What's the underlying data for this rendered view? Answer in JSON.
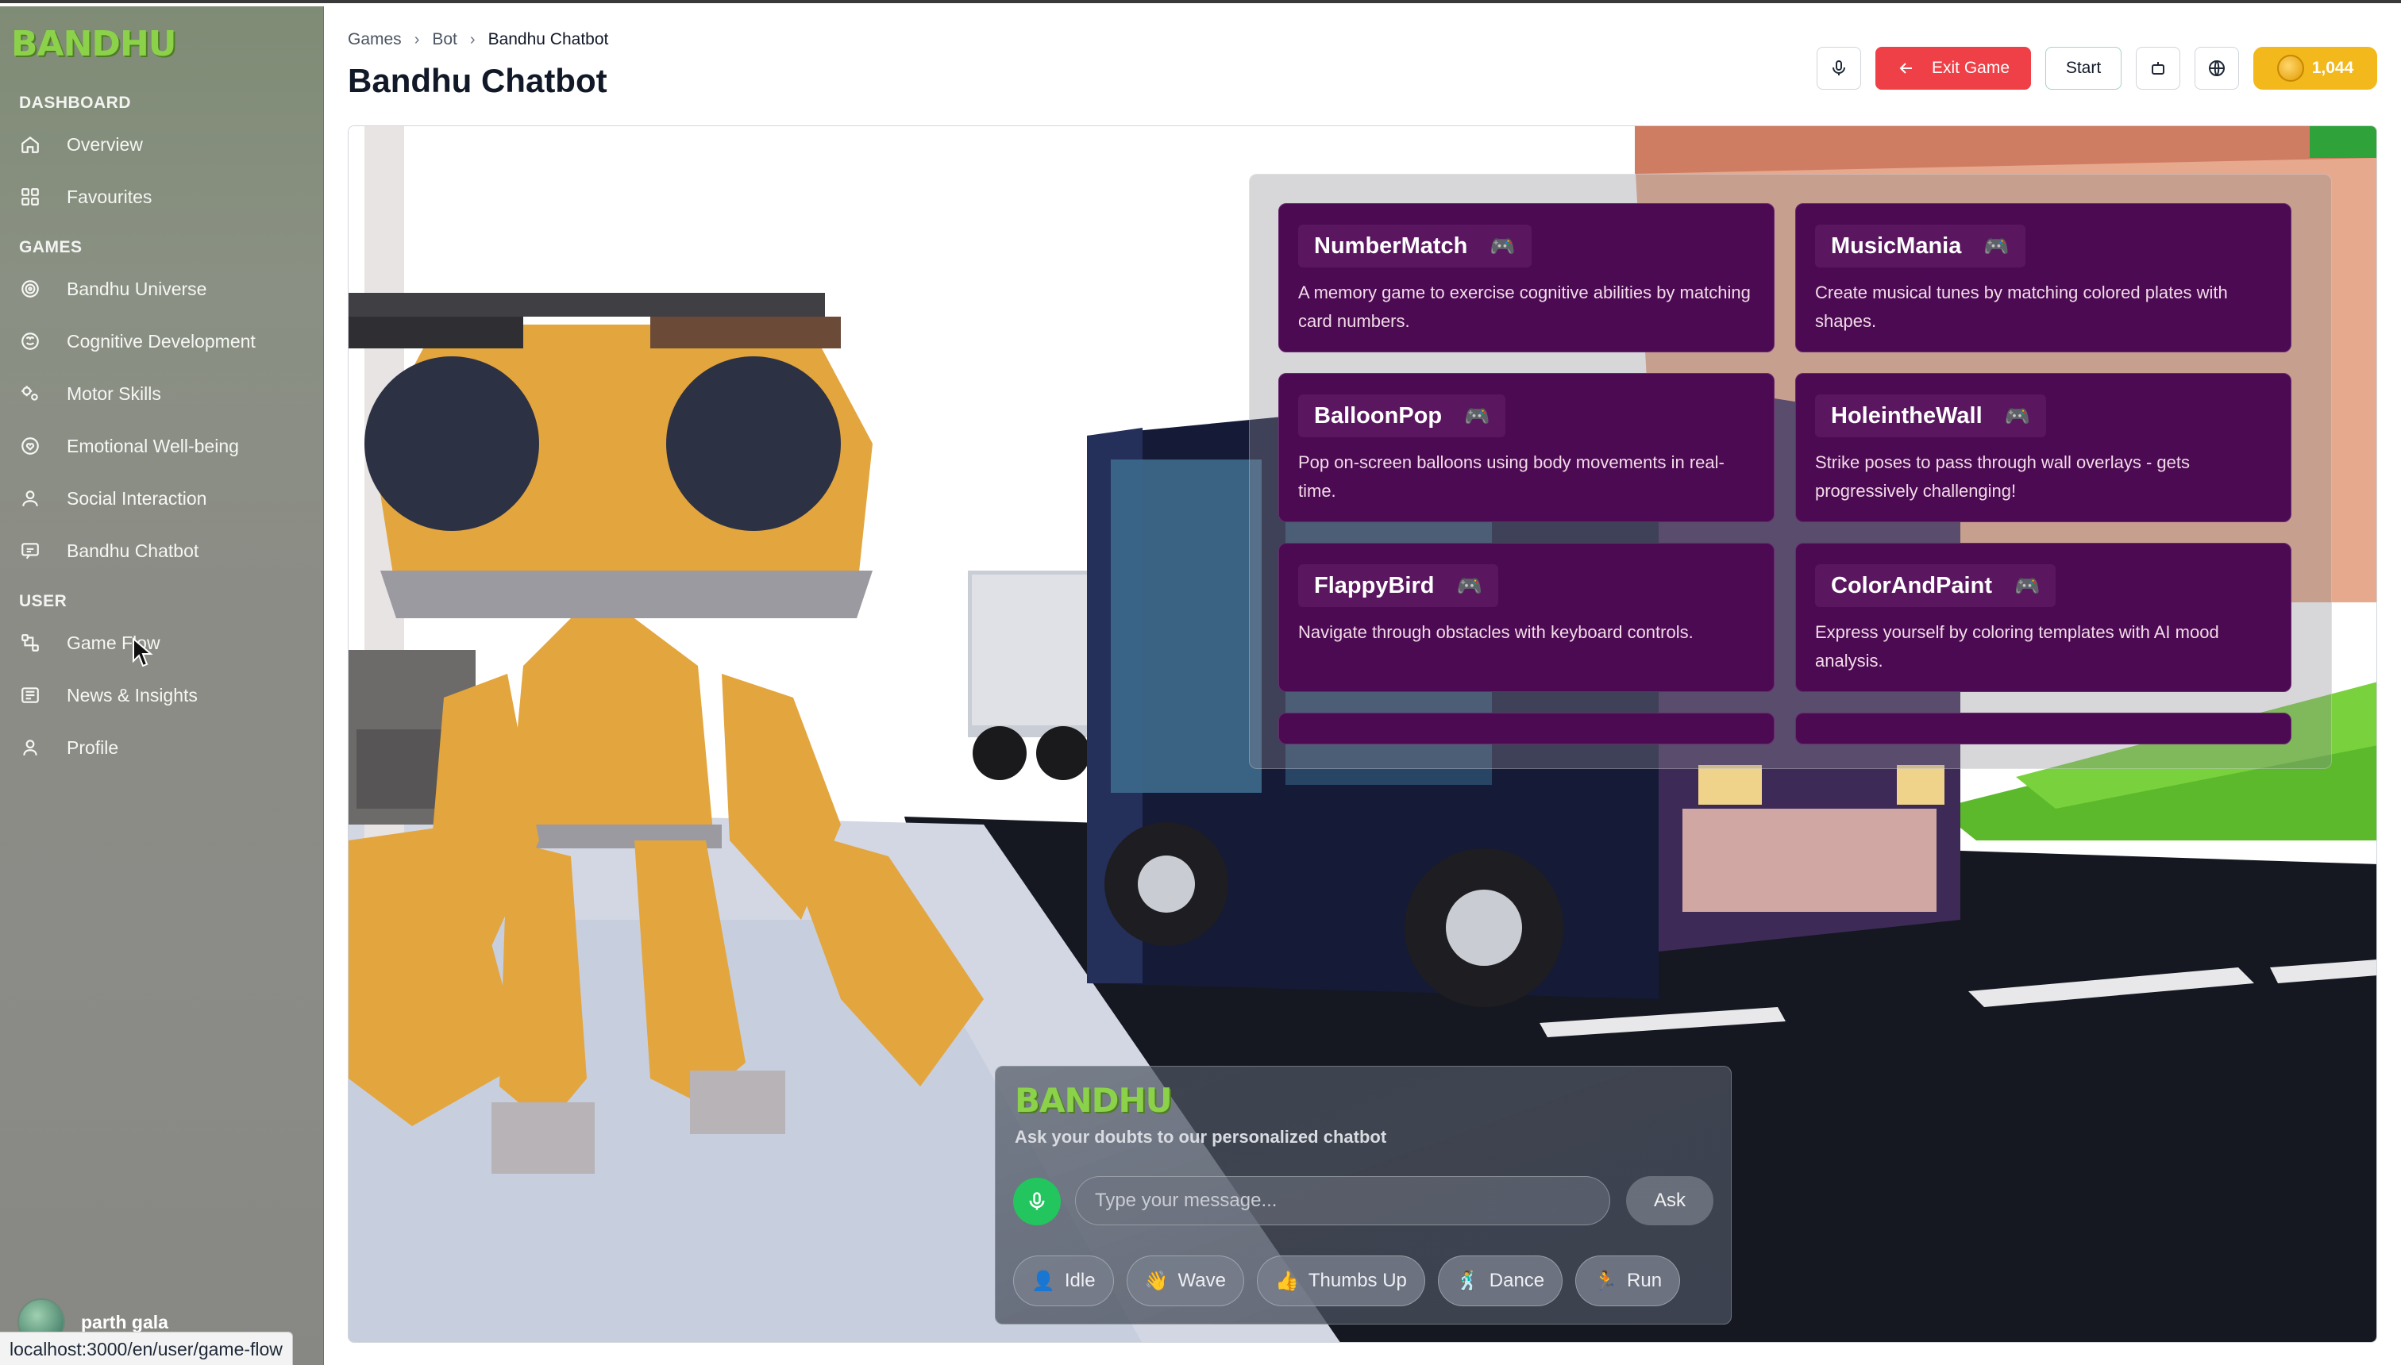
{
  "sidebar": {
    "logo": "BANDHU",
    "sections": {
      "dashboard": "DASHBOARD",
      "games": "GAMES",
      "user": "USER"
    },
    "items": [
      {
        "label": "Overview",
        "icon": "home-icon"
      },
      {
        "label": "Favourites",
        "icon": "grid-icon"
      },
      {
        "label": "Bandhu Universe",
        "icon": "target-icon"
      },
      {
        "label": "Cognitive Development",
        "icon": "brain-icon"
      },
      {
        "label": "Motor Skills",
        "icon": "gears-icon"
      },
      {
        "label": "Emotional Well-being",
        "icon": "heart-circle-icon"
      },
      {
        "label": "Social Interaction",
        "icon": "users-icon"
      },
      {
        "label": "Bandhu Chatbot",
        "icon": "chat-icon"
      },
      {
        "label": "Game Flow",
        "icon": "flow-icon"
      },
      {
        "label": "News & Insights",
        "icon": "news-icon"
      },
      {
        "label": "Profile",
        "icon": "user-icon"
      }
    ],
    "user_name": "parth gala"
  },
  "status_bar_url": "localhost:3000/en/user/game-flow",
  "breadcrumb": [
    "Games",
    "Bot",
    "Bandhu Chatbot"
  ],
  "page_title": "Bandhu Chatbot",
  "toolbar": {
    "exit_label": "Exit Game",
    "start_label": "Start",
    "coins": "1,044",
    "colors": {
      "exit": "#ef3f47",
      "coins": "#f2b81c"
    }
  },
  "games": [
    {
      "name": "NumberMatch",
      "desc": "A memory game to exercise cognitive abilities by matching card numbers."
    },
    {
      "name": "MusicMania",
      "desc": "Create musical tunes by matching colored plates with shapes."
    },
    {
      "name": "BalloonPop",
      "desc": "Pop on-screen balloons using body movements in real-time."
    },
    {
      "name": "HoleintheWall",
      "desc": "Strike poses to pass through wall overlays - gets progressively challenging!"
    },
    {
      "name": "FlappyBird",
      "desc": "Navigate through obstacles with keyboard controls."
    },
    {
      "name": "ColorAndPaint",
      "desc": "Express yourself by coloring templates with AI mood analysis."
    }
  ],
  "game_pad_icon": "🎮",
  "chat": {
    "logo": "BANDHU",
    "subtitle": "Ask your doubts to our personalized chatbot",
    "placeholder": "Type your message...",
    "ask_label": "Ask",
    "actions": [
      {
        "emoji": "👤",
        "label": "Idle"
      },
      {
        "emoji": "👋",
        "label": "Wave"
      },
      {
        "emoji": "👍",
        "label": "Thumbs Up"
      },
      {
        "emoji": "🕺",
        "label": "Dance"
      },
      {
        "emoji": "🏃",
        "label": "Run"
      }
    ]
  }
}
